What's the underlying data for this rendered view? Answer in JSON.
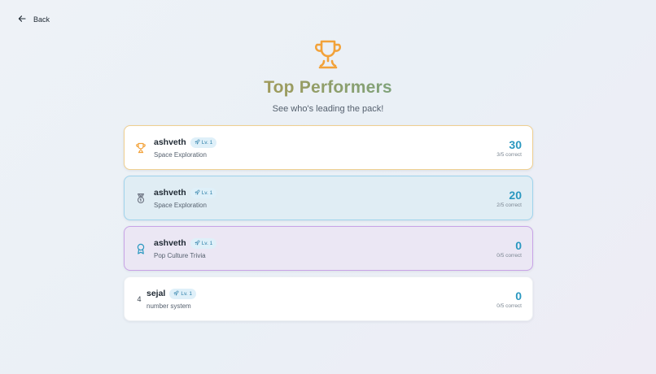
{
  "nav": {
    "back_label": "Back",
    "back_icon": "arrow-left-icon"
  },
  "hero": {
    "icon": "trophy-icon",
    "title": "Top Performers",
    "subtitle": "See who's leading the pack!"
  },
  "colors": {
    "gold": "#f2a23a",
    "silver": "#6b7280",
    "bronze": "#2a98c0",
    "score": "#2a98c0",
    "badge_text": "#2d7fa8"
  },
  "leaderboard": [
    {
      "rank_icon": "trophy-icon",
      "name": "ashveth",
      "level": "Lv. 1",
      "topic": "Space Exploration",
      "score": "30",
      "correct": "3/5 correct"
    },
    {
      "rank_icon": "medal-icon",
      "name": "ashveth",
      "level": "Lv. 1",
      "topic": "Space Exploration",
      "score": "20",
      "correct": "2/5 correct"
    },
    {
      "rank_icon": "award-ribbon-icon",
      "name": "ashveth",
      "level": "Lv. 1",
      "topic": "Pop Culture Trivia",
      "score": "0",
      "correct": "0/5 correct"
    },
    {
      "rank": "4",
      "name": "sejal",
      "level": "Lv. 1",
      "topic": "number system",
      "score": "0",
      "correct": "0/5 correct"
    }
  ]
}
